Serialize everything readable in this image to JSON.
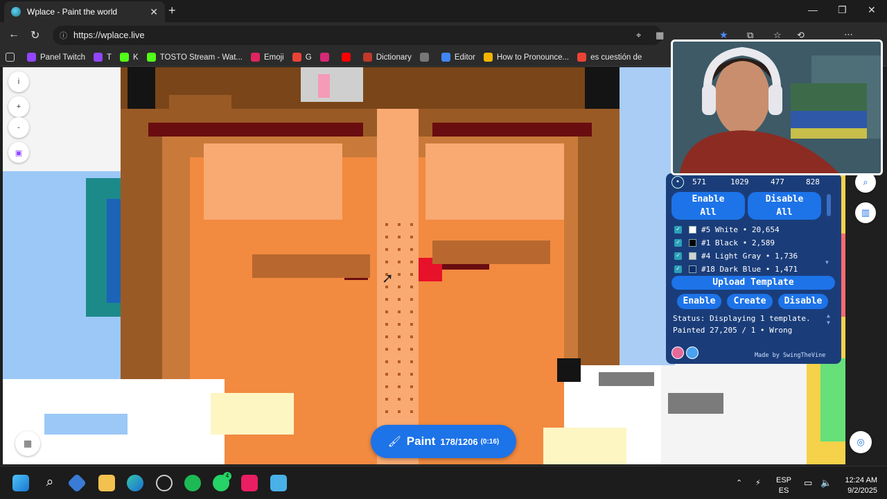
{
  "browser": {
    "tab_title": "Wplace - Paint the world",
    "url": "https://wplace.live"
  },
  "bookmarks": [
    {
      "label": "Panel Twitch",
      "color": "#9146ff"
    },
    {
      "label": "T",
      "color": "#9146ff"
    },
    {
      "label": "K",
      "color": "#53fc18"
    },
    {
      "label": "TOSTO Stream - Wat...",
      "color": "#53fc18"
    },
    {
      "label": "Emoji",
      "color": "#e0245e"
    },
    {
      "label": "G",
      "color": "#ea4335"
    },
    {
      "label": "",
      "color": "#d62976"
    },
    {
      "label": "",
      "color": "#ff0000"
    },
    {
      "label": "Dictionary",
      "color": "#c0392b"
    },
    {
      "label": "",
      "color": "#777777"
    },
    {
      "label": "Editor",
      "color": "#4285f4"
    },
    {
      "label": "How to Pronounce...",
      "color": "#f4b400"
    },
    {
      "label": "es cuestión de",
      "color": "#ea4335"
    }
  ],
  "left_tools": [
    {
      "name": "info-button",
      "label": "i"
    },
    {
      "name": "zoom-in-button",
      "label": "+"
    },
    {
      "name": "zoom-out-button",
      "label": "-"
    },
    {
      "name": "twitch-button",
      "label": "▣"
    }
  ],
  "paint": {
    "label": "Paint",
    "count": "178/1206",
    "timer": "(0:16)"
  },
  "template_panel": {
    "coords": [
      "571",
      "1029",
      "477",
      "828"
    ],
    "enable_all": [
      "Enable",
      "All"
    ],
    "disable_all": [
      "Disable",
      "All"
    ],
    "colors": [
      {
        "text": "#5 White • 20,654",
        "swatch": "#ffffff"
      },
      {
        "text": "#1 Black • 2,589",
        "swatch": "#000000"
      },
      {
        "text": "#4 Light Gray • 1,736",
        "swatch": "#d2d2d2"
      },
      {
        "text": "#18 Dark Blue • 1,471",
        "swatch": "#0c2e6e"
      }
    ],
    "upload_label": "Upload Template",
    "enable_label": "Enable",
    "create_label": "Create",
    "disable_label": "Disable",
    "status_text": "Status: Displaying 1 template.",
    "status_cut": "Painted 27,205 / 1 • Wrong",
    "credit": "Made by SwingTheVine"
  },
  "taskbar": {
    "lang_top": "ESP",
    "lang_bottom": "ES",
    "time": "12:24 AM",
    "date": "9/2/2025",
    "whatsapp_badge": "4"
  }
}
